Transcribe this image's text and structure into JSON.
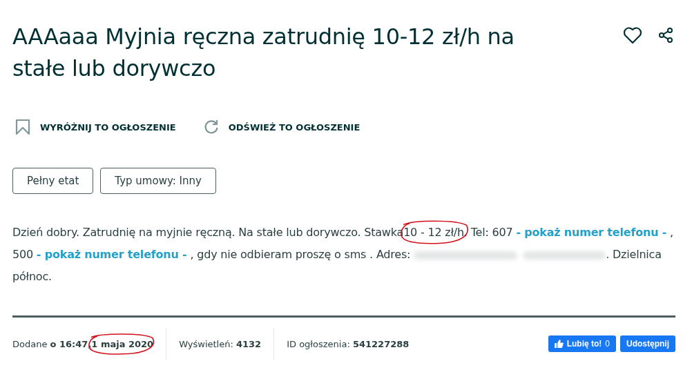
{
  "title": "AAAaaa Myjnia ręczna zatrudnię 10-12 zł/h na stałe lub dorywczo",
  "header_icons": [
    {
      "kind": "heart"
    },
    {
      "kind": "share"
    }
  ],
  "actions": [
    {
      "kind": "bookmark",
      "label": "WYRÓŻNIJ TO OGŁOSZENIE"
    },
    {
      "kind": "refresh",
      "label": "ODŚWIEŻ TO OGŁOSZENIE"
    }
  ],
  "tags": [
    "Pełny etat",
    "Typ umowy: Inny"
  ],
  "description": [
    {
      "kind": "text",
      "text": "Dzień dobry. Zatrudnię na myjnie ręczną. Na stałe lub dorywczo. Stawka"
    },
    {
      "kind": "circled",
      "text": "10 - 12 zł/h."
    },
    {
      "kind": "text",
      "text": " Tel: 607 "
    },
    {
      "kind": "link",
      "text": "- pokaż numer telefonu -"
    },
    {
      "kind": "text",
      "text": " , 500 "
    },
    {
      "kind": "link",
      "text": "- pokaż numer telefonu -"
    },
    {
      "kind": "text",
      "text": " , gdy nie odbieram proszę o sms . Adres: "
    },
    {
      "kind": "blurred"
    },
    {
      "kind": "text",
      "text": ". Dzielnica północ."
    }
  ],
  "footer": {
    "added": {
      "label": "Dodane",
      "time": "o 16:47,",
      "date": "1 maja 2020",
      "circled": true
    },
    "views": {
      "label": "Wyświetleń:",
      "value": "4132"
    },
    "ad_id": {
      "label": "ID ogłoszenia:",
      "value": "541227288"
    },
    "like_button": {
      "label": "Lubię to!",
      "count": "0"
    },
    "share_button": {
      "label": "Udostępnij"
    }
  }
}
